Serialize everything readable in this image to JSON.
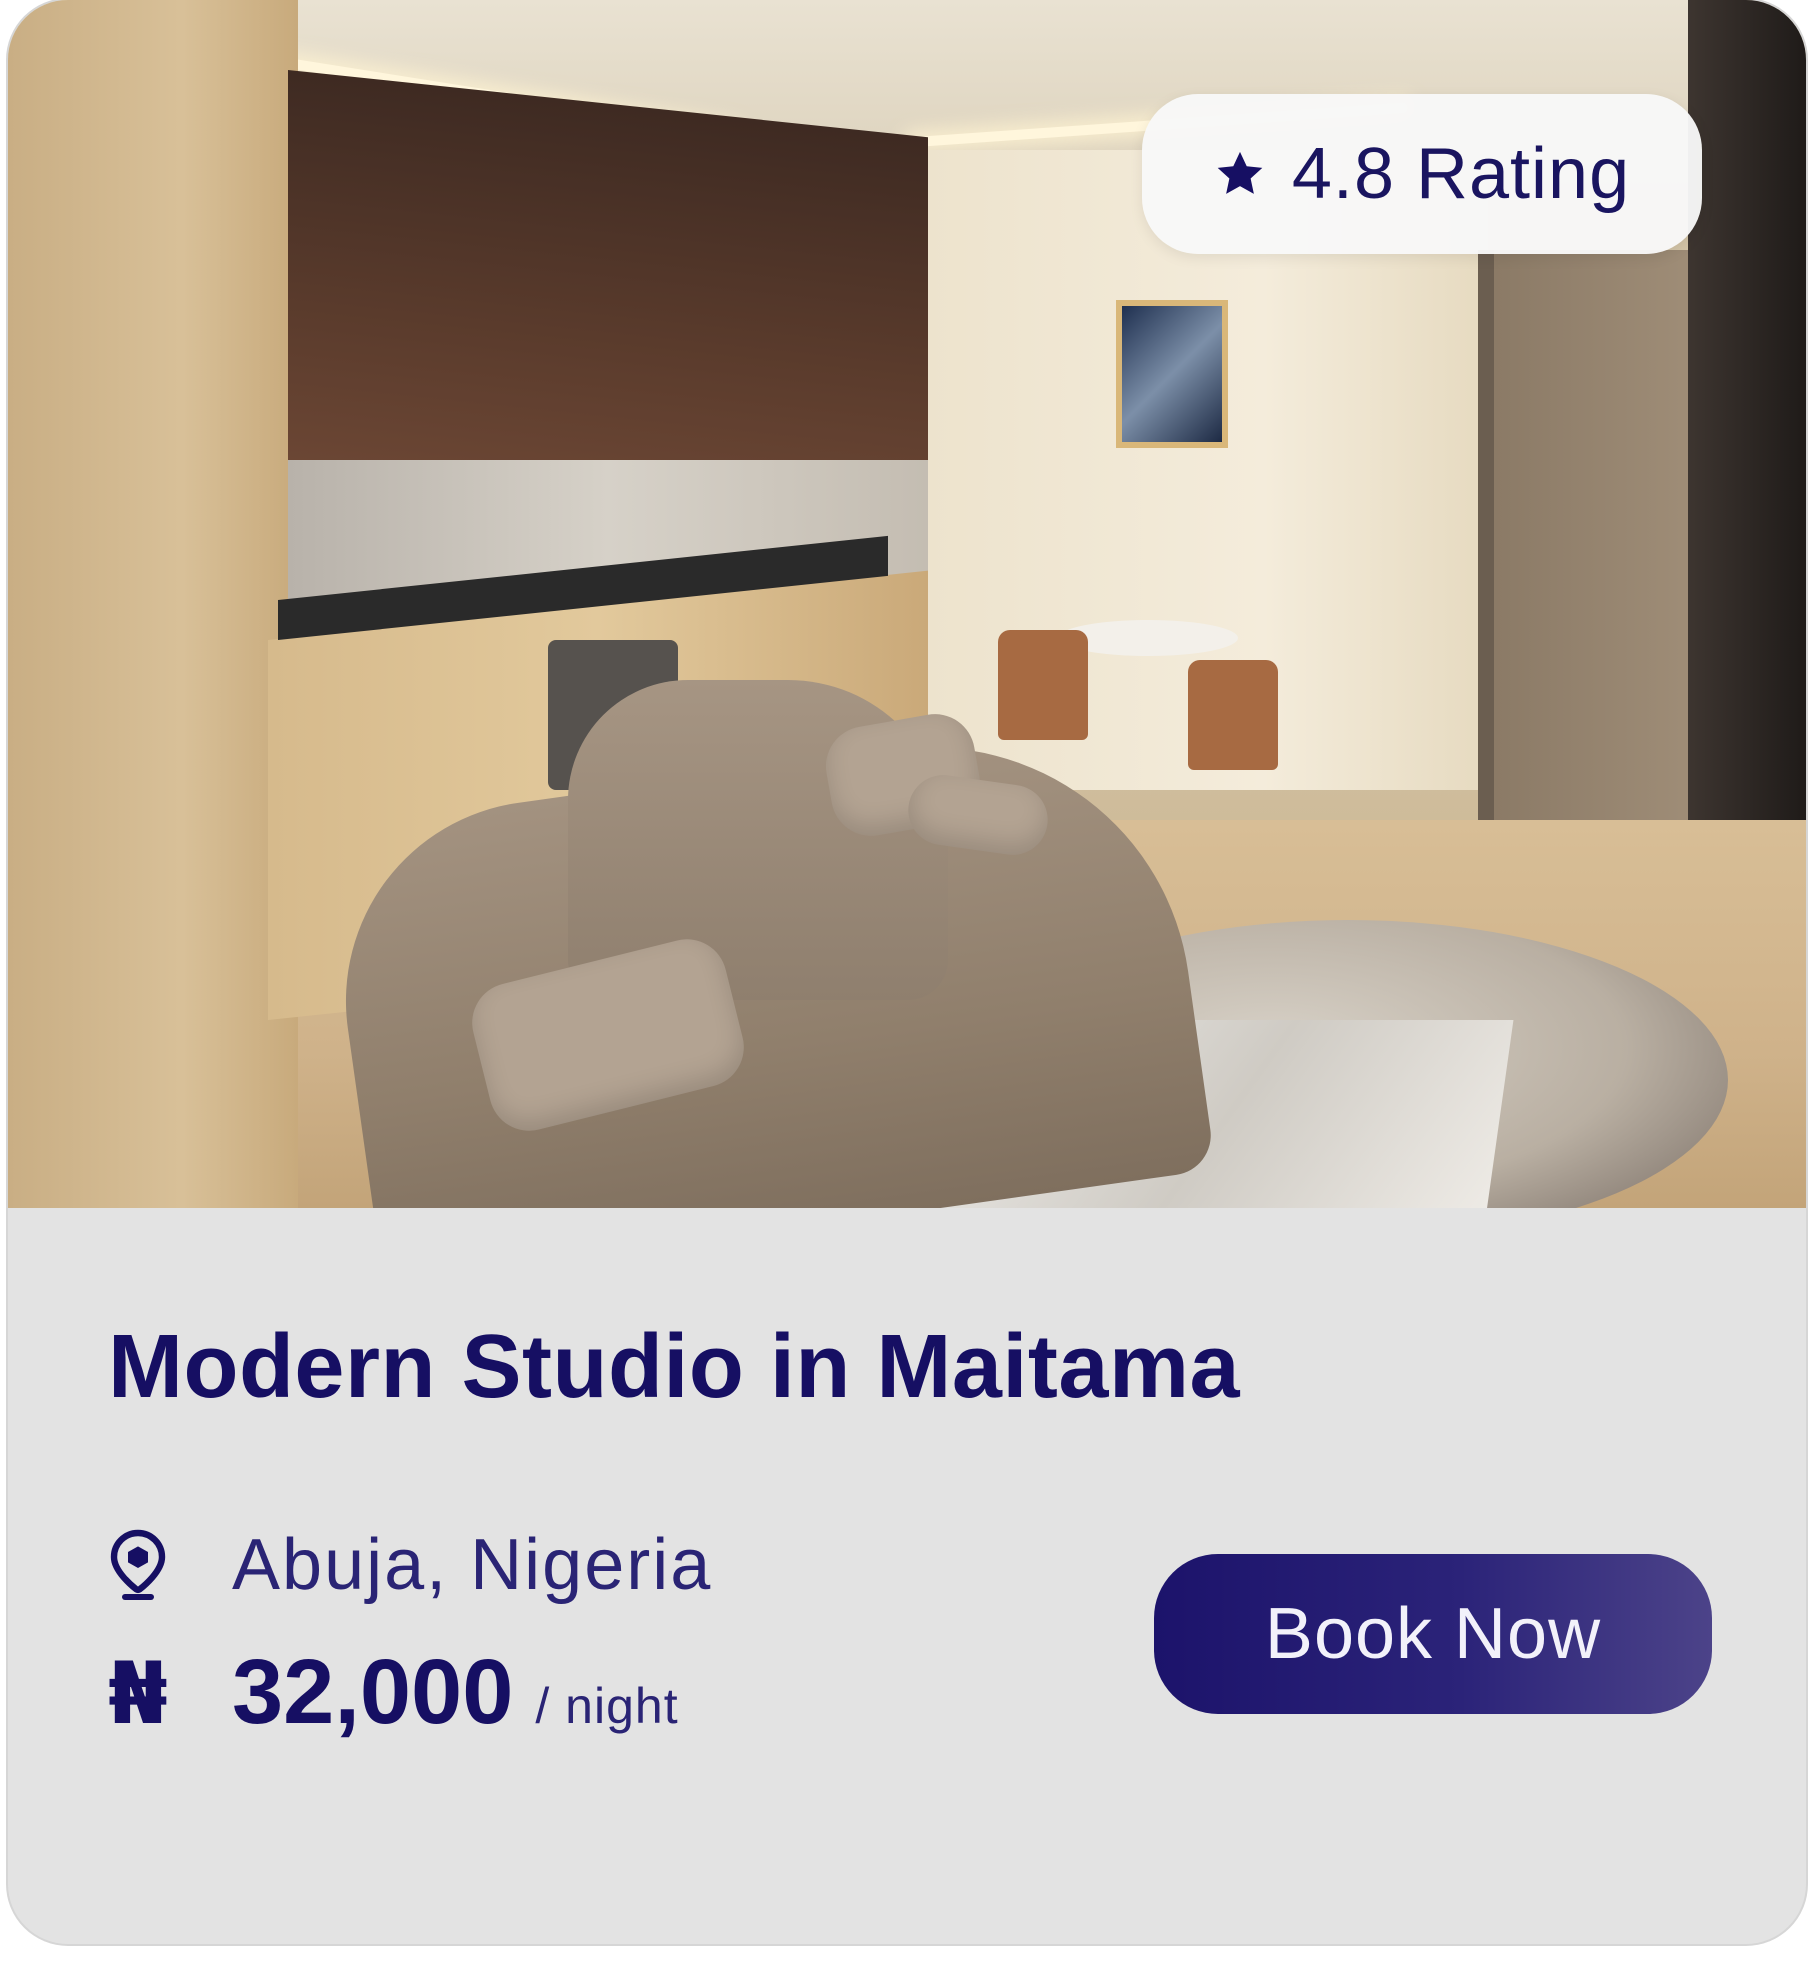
{
  "listing": {
    "rating_text": "4.8 Rating",
    "title": "Modern Studio in Maitama",
    "location": "Abuja, Nigeria",
    "currency_symbol": "₦",
    "price": "32,000",
    "price_unit": "/ night",
    "book_label": "Book Now"
  },
  "icons": {
    "rating": "star-icon",
    "location": "location-pin-icon"
  },
  "colors": {
    "primary_text": "#160f63",
    "button_start": "#1c136b",
    "button_end": "#4c4389",
    "card_background": "#e3e3e3",
    "badge_background": "#f8f8f8"
  }
}
